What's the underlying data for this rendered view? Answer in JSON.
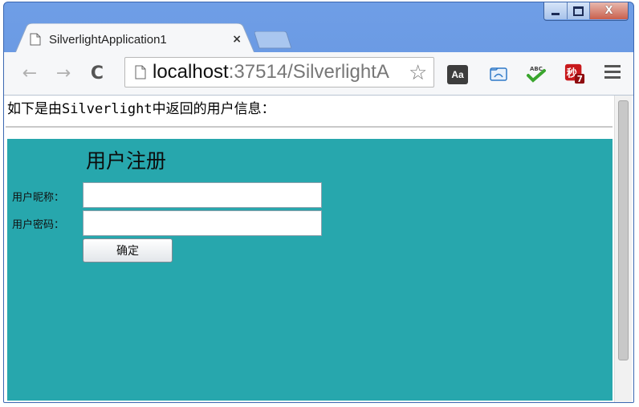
{
  "window": {
    "caption_buttons": [
      "minimize",
      "maximize",
      "close"
    ],
    "close_glyph": "X"
  },
  "tabs": [
    {
      "title": "SilverlightApplication1",
      "close_glyph": "×",
      "active": true
    }
  ],
  "toolbar": {
    "back_glyph": "←",
    "forward_glyph": "→",
    "reload_glyph": "C",
    "url_host": "localhost",
    "url_rest": ":37514/SilverlightA",
    "star_glyph": "☆",
    "extensions": [
      {
        "name": "aa-icon",
        "text": "Aa"
      },
      {
        "name": "reader-icon"
      },
      {
        "name": "abc-spellcheck-icon"
      },
      {
        "name": "security-7-icon"
      }
    ]
  },
  "page": {
    "info_text": "如下是由Silverlight中返回的用户信息：",
    "form": {
      "title": "用户注册",
      "nickname_label": "用户昵称：",
      "nickname_value": "",
      "password_label": "用户密码：",
      "password_value": "",
      "submit_label": "确定",
      "background_color": "#27a7ad"
    }
  }
}
